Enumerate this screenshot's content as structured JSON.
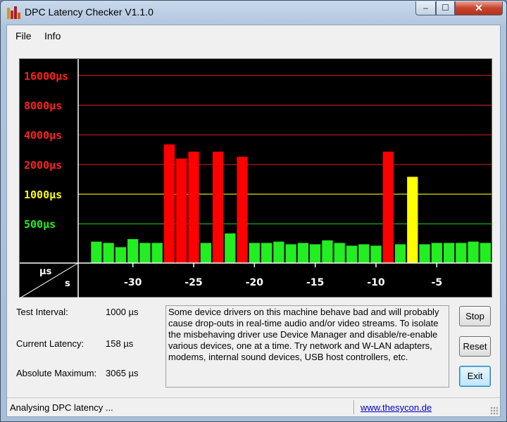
{
  "window": {
    "title": "DPC Latency Checker V1.1.0",
    "controls": {
      "minimize": "–",
      "maximize": "☐",
      "close": "✕"
    }
  },
  "menu": {
    "file": "File",
    "info": "Info"
  },
  "chart_data": {
    "type": "bar",
    "y_scale": "log",
    "y_ticks": [
      {
        "label": "16000µs",
        "value": 16000,
        "color": "#ff2020"
      },
      {
        "label": "8000µs",
        "value": 8000,
        "color": "#ff2020"
      },
      {
        "label": "4000µs",
        "value": 4000,
        "color": "#ff2020"
      },
      {
        "label": "2000µs",
        "value": 2000,
        "color": "#ff2020"
      },
      {
        "label": "1000µs",
        "value": 1000,
        "color": "#ffff00"
      },
      {
        "label": "500µs",
        "value": 500,
        "color": "#22ee22"
      }
    ],
    "x_ticks": [
      -30,
      -25,
      -20,
      -15,
      -10,
      -5
    ],
    "x_tick_labels": [
      "-30",
      "-25",
      "-20",
      "-15",
      "-10",
      "-5"
    ],
    "axis_corner_top": "µs",
    "axis_corner_bottom": "s",
    "x_range": [
      -34,
      -1
    ],
    "y_range": [
      200,
      22000
    ],
    "bars": [
      {
        "x": -33,
        "value": 330
      },
      {
        "x": -32,
        "value": 320
      },
      {
        "x": -31,
        "value": 290
      },
      {
        "x": -30,
        "value": 350
      },
      {
        "x": -29,
        "value": 320
      },
      {
        "x": -28,
        "value": 320
      },
      {
        "x": -27,
        "value": 3200
      },
      {
        "x": -26,
        "value": 2300
      },
      {
        "x": -25,
        "value": 2700
      },
      {
        "x": -24,
        "value": 320
      },
      {
        "x": -23,
        "value": 2700
      },
      {
        "x": -22,
        "value": 400
      },
      {
        "x": -21,
        "value": 2400
      },
      {
        "x": -20,
        "value": 320
      },
      {
        "x": -19,
        "value": 320
      },
      {
        "x": -18,
        "value": 330
      },
      {
        "x": -17,
        "value": 310
      },
      {
        "x": -16,
        "value": 320
      },
      {
        "x": -15,
        "value": 310
      },
      {
        "x": -14,
        "value": 340
      },
      {
        "x": -13,
        "value": 320
      },
      {
        "x": -12,
        "value": 300
      },
      {
        "x": -11,
        "value": 310
      },
      {
        "x": -10,
        "value": 300
      },
      {
        "x": -9,
        "value": 2700
      },
      {
        "x": -8,
        "value": 310
      },
      {
        "x": -7,
        "value": 1500
      },
      {
        "x": -6,
        "value": 310
      },
      {
        "x": -5,
        "value": 320
      },
      {
        "x": -4,
        "value": 320
      },
      {
        "x": -3,
        "value": 320
      },
      {
        "x": -2,
        "value": 330
      },
      {
        "x": -1,
        "value": 320
      }
    ],
    "colors": {
      "green": "#22ee22",
      "yellow": "#ffff00",
      "red": "#ff0000",
      "grid_red": "#b01818",
      "grid_yellow": "#c8c800",
      "grid_green": "#18b018"
    }
  },
  "stats": {
    "test_interval_label": "Test Interval:",
    "test_interval_value": "1000 µs",
    "current_latency_label": "Current Latency:",
    "current_latency_value": "158 µs",
    "absolute_maximum_label": "Absolute Maximum:",
    "absolute_maximum_value": "3065 µs"
  },
  "message": "Some device drivers on this machine behave bad and will probably cause drop-outs in real-time audio and/or video streams. To isolate the misbehaving driver use Device Manager and disable/re-enable various devices, one at a time. Try network and W-LAN adapters, modems, internal sound devices, USB host controllers, etc.",
  "buttons": {
    "stop": "Stop",
    "reset": "Reset",
    "exit": "Exit"
  },
  "status": {
    "text": "Analysing DPC latency ...",
    "link": "www.thesycon.de"
  }
}
